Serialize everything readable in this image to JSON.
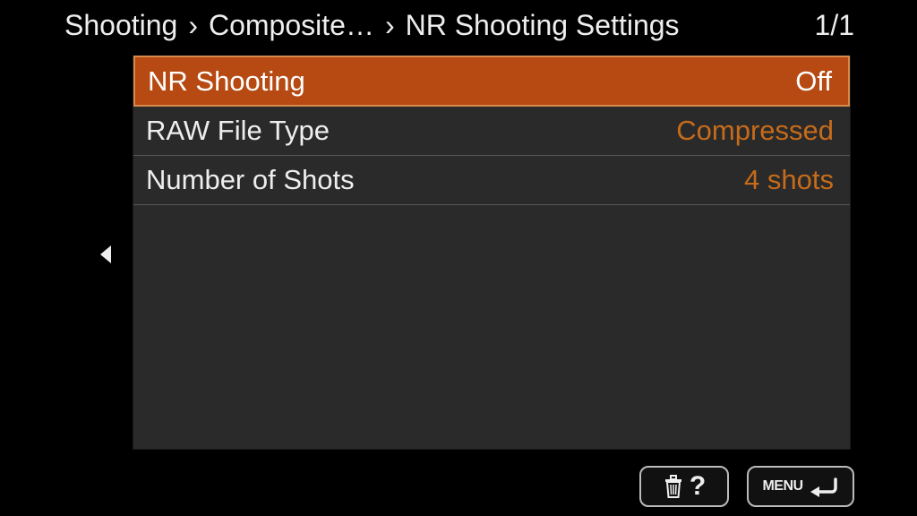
{
  "colors": {
    "accent": "#c66b1a",
    "selected_bg": "#b64a12",
    "selected_border": "#d98a4a"
  },
  "breadcrumb": {
    "items": [
      "Shooting",
      "Composite…",
      "NR Shooting Settings"
    ],
    "page_indicator": "1/1"
  },
  "menu": {
    "items": [
      {
        "label": "NR Shooting",
        "value": "Off",
        "selected": true
      },
      {
        "label": "RAW File Type",
        "value": "Compressed",
        "selected": false
      },
      {
        "label": "Number of Shots",
        "value": "4 shots",
        "selected": false
      }
    ]
  },
  "footer": {
    "help_label": "?",
    "menu_label": "MENU"
  },
  "icons": {
    "back_arrow": "chevron-left-icon",
    "trash": "trash-icon",
    "return": "return-icon"
  }
}
